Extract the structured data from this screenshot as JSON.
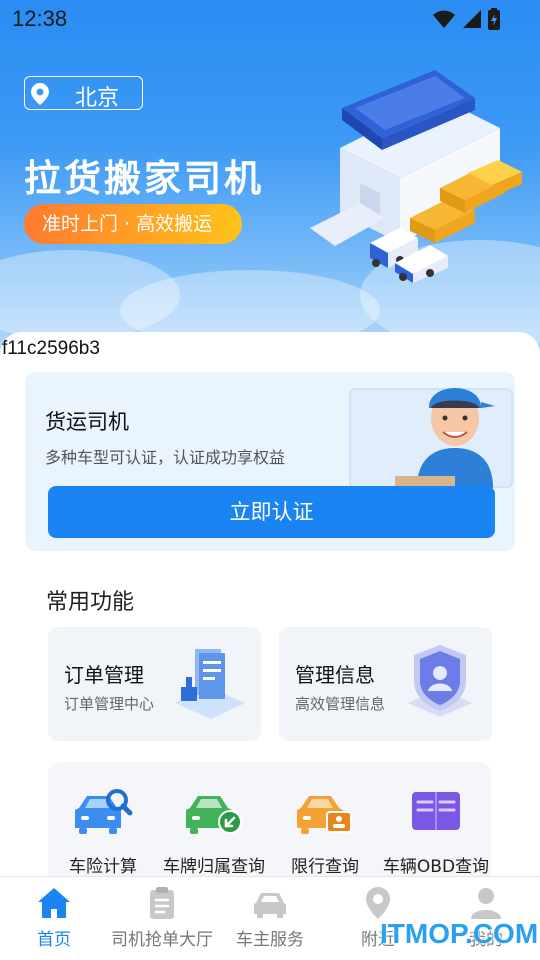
{
  "status_bar": {
    "time": "12:38"
  },
  "header": {
    "city": "北京",
    "title": "拉货搬家司机",
    "slogan": "准时上门 · 高效搬运"
  },
  "debug_code": "f11c2596b3",
  "driver_card": {
    "title": "货运司机",
    "subtitle": "多种车型可认证，认证成功享权益",
    "button": "立即认证"
  },
  "common_functions": {
    "title": "常用功能",
    "tiles": [
      {
        "title": "订单管理",
        "subtitle": "订单管理中心"
      },
      {
        "title": "管理信息",
        "subtitle": "高效管理信息"
      }
    ],
    "tools": [
      {
        "label": "车险计算",
        "icon": "car-search-icon"
      },
      {
        "label": "车牌归属查询",
        "icon": "car-plate-icon"
      },
      {
        "label": "限行查询",
        "icon": "car-restriction-icon"
      },
      {
        "label": "车辆OBD查询",
        "icon": "book-icon"
      }
    ]
  },
  "tabbar": {
    "items": [
      {
        "label": "首页",
        "icon": "home-icon",
        "active": true
      },
      {
        "label": "司机抢单大厅",
        "icon": "clipboard-icon",
        "active": false
      },
      {
        "label": "车主服务",
        "icon": "car-icon",
        "active": false
      },
      {
        "label": "附近",
        "icon": "location-icon",
        "active": false
      },
      {
        "label": "我的",
        "icon": "user-icon",
        "active": false
      }
    ]
  },
  "watermark": "ITMOP.COM",
  "colors": {
    "primary": "#1a84f2",
    "slogan_start": "#ff7a2e",
    "slogan_end": "#ffc31a"
  }
}
